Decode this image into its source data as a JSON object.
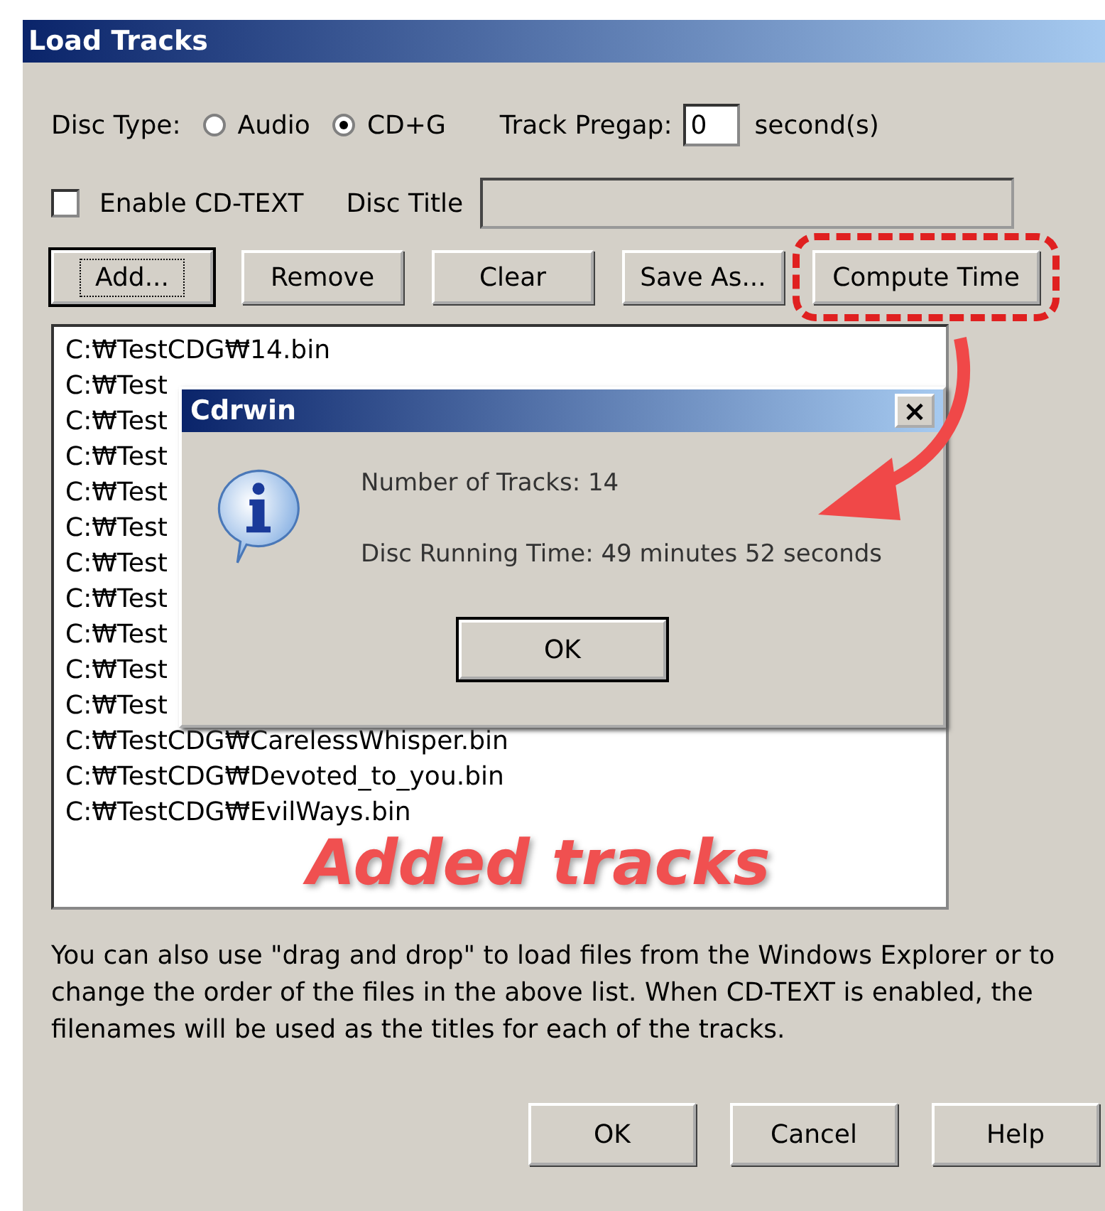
{
  "window": {
    "title": "Load Tracks"
  },
  "disc_type": {
    "label": "Disc Type:",
    "options": [
      {
        "label": "Audio",
        "selected": false
      },
      {
        "label": "CD+G",
        "selected": true
      }
    ]
  },
  "track_pregap": {
    "label": "Track Pregap:",
    "value": "0",
    "unit": "second(s)"
  },
  "cd_text": {
    "label": "Enable CD-TEXT",
    "checked": false
  },
  "disc_title": {
    "label": "Disc Title",
    "disabled": true
  },
  "buttons": [
    {
      "label": "Add...",
      "focused": true,
      "highlighted": false
    },
    {
      "label": "Remove",
      "focused": false,
      "highlighted": false
    },
    {
      "label": "Clear",
      "focused": false,
      "highlighted": false
    },
    {
      "label": "Save As...",
      "focused": false,
      "highlighted": false
    },
    {
      "label": "Compute Time",
      "focused": false,
      "highlighted": true
    }
  ],
  "tracks": [
    "C:₩TestCDG₩14.bin",
    "C:₩Test",
    "C:₩Test",
    "C:₩Test",
    "C:₩Test",
    "C:₩Test",
    "C:₩Test",
    "C:₩Test",
    "C:₩Test",
    "C:₩Test",
    "C:₩Test",
    "C:₩TestCDG₩CarelessWhisper.bin",
    "C:₩TestCDG₩Devoted_to_you.bin",
    "C:₩TestCDG₩EvilWays.bin"
  ],
  "help_text": "You can also use \"drag and drop\" to load files from the Windows Explorer or to change the order of the files in the above list. When CD-TEXT is enabled, the filenames will be used as the titles for each of the tracks.",
  "footer_buttons": [
    {
      "label": "OK"
    },
    {
      "label": "Cancel"
    },
    {
      "label": "Help"
    }
  ],
  "dialog": {
    "title": "Cdrwin",
    "close": "×",
    "lines": [
      "Number of Tracks: 14",
      "Disc Running Time: 49 minutes 52 seconds"
    ],
    "button": "OK"
  },
  "annotation": {
    "caption": "Added tracks"
  }
}
